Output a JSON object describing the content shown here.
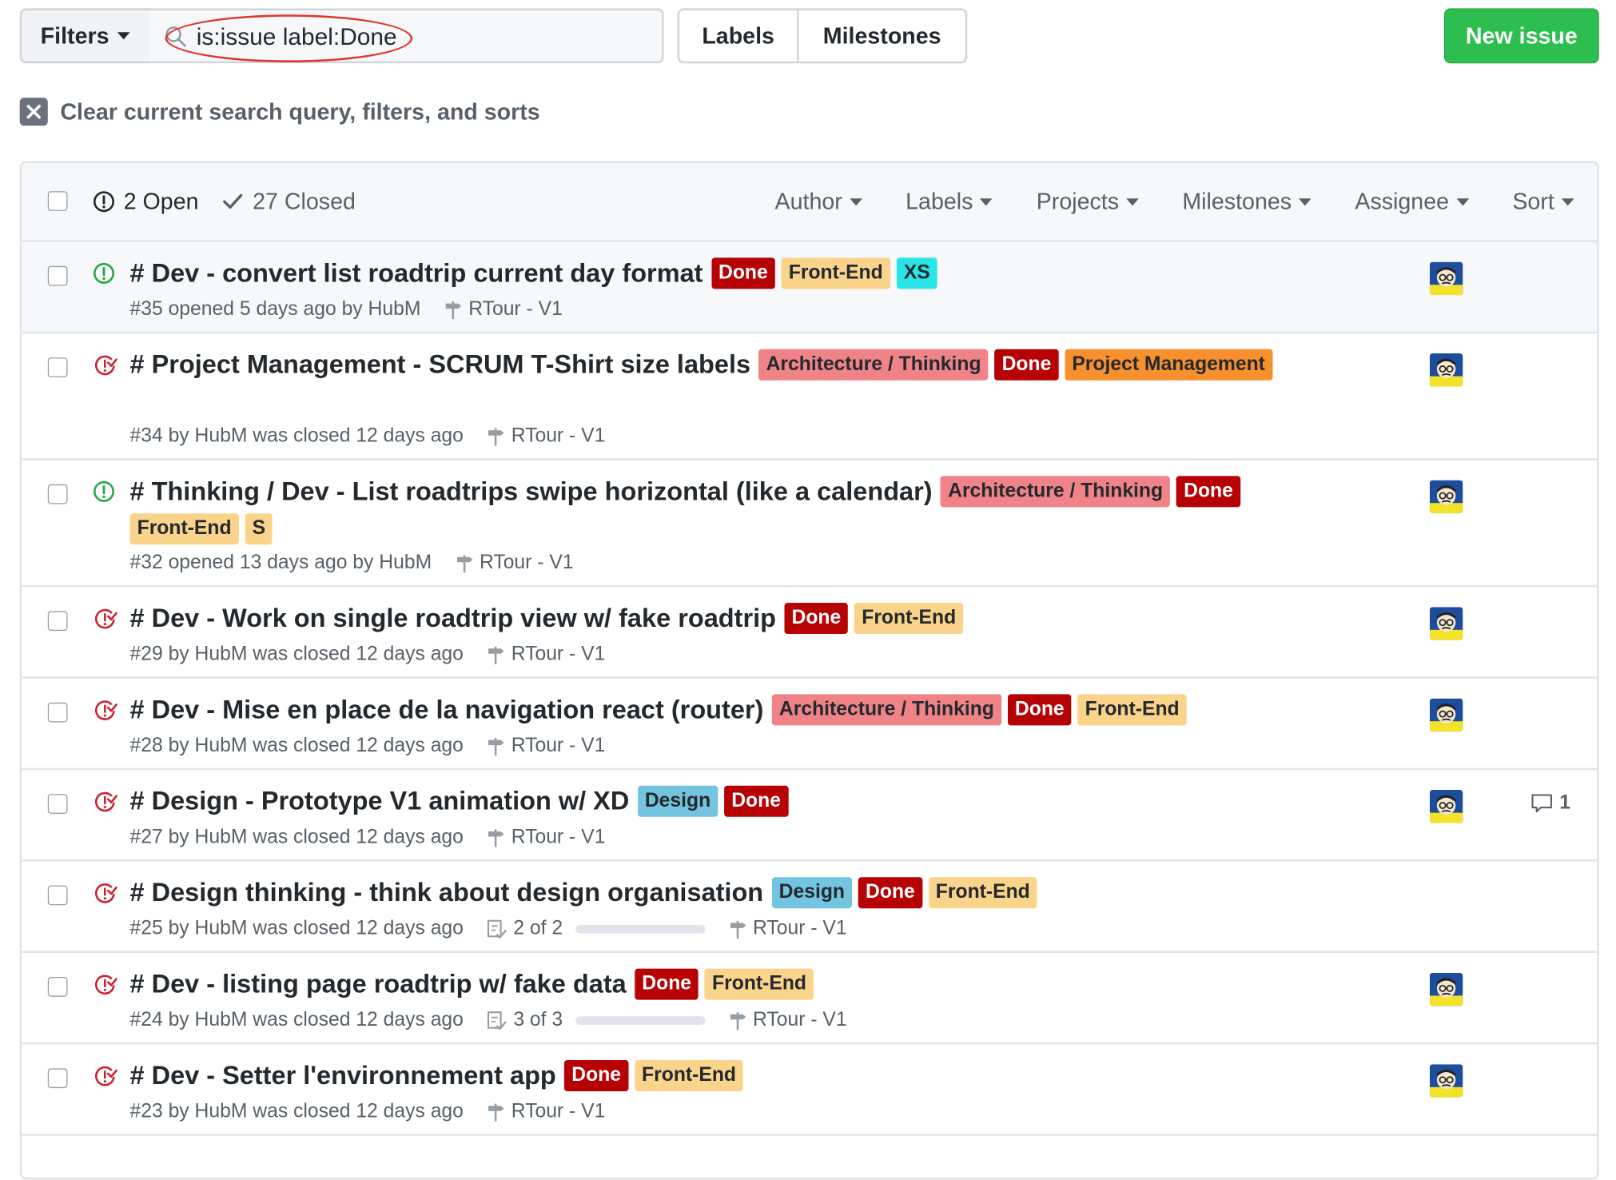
{
  "topbar": {
    "filters_label": "Filters",
    "search_value": "is:issue label:Done",
    "labels_btn": "Labels",
    "milestones_btn": "Milestones",
    "new_issue_btn": "New issue"
  },
  "clear_query": "Clear current search query, filters, and sorts",
  "header": {
    "open_count": "2 Open",
    "closed_count": "27 Closed",
    "filters": [
      "Author",
      "Labels",
      "Projects",
      "Milestones",
      "Assignee",
      "Sort"
    ]
  },
  "colors": {
    "Done": {
      "bg": "#b60205",
      "fg": "#ffffff"
    },
    "Front-End": {
      "bg": "#fbd48c",
      "fg": "#24292e"
    },
    "XS": {
      "bg": "#2ae5e8",
      "fg": "#24292e"
    },
    "Architecture / Thinking": {
      "bg": "#ef8387",
      "fg": "#24292e"
    },
    "Project Management": {
      "bg": "#f8902e",
      "fg": "#24292e"
    },
    "S": {
      "bg": "#fbd48c",
      "fg": "#24292e"
    },
    "Design": {
      "bg": "#73c4df",
      "fg": "#24292e"
    },
    "open_icon": "#28a745",
    "closed_icon": "#cb2431"
  },
  "issues": [
    {
      "state": "open",
      "title": "# Dev - convert list roadtrip current day format",
      "labels": [
        "Done",
        "Front-End",
        "XS"
      ],
      "meta": "#35 opened 5 days ago by HubM",
      "milestone": "RTour - V1",
      "avatar": true,
      "highlight": true
    },
    {
      "state": "closed",
      "title": "# Project Management - SCRUM T-Shirt size labels",
      "labels": [
        "Architecture / Thinking",
        "Done",
        "Project Management"
      ],
      "meta": "#34 by HubM was closed 12 days ago",
      "milestone": "RTour - V1",
      "avatar": true
    },
    {
      "state": "open",
      "title": "# Thinking / Dev - List roadtrips swipe horizontal (like a calendar)",
      "labels": [
        "Architecture / Thinking",
        "Done",
        "Front-End",
        "S"
      ],
      "meta": "#32 opened 13 days ago by HubM",
      "milestone": "RTour - V1",
      "avatar": true
    },
    {
      "state": "closed",
      "title": "# Dev - Work on single roadtrip view w/ fake roadtrip",
      "labels": [
        "Done",
        "Front-End"
      ],
      "meta": "#29 by HubM was closed 12 days ago",
      "milestone": "RTour - V1",
      "avatar": true
    },
    {
      "state": "closed",
      "title": "# Dev - Mise en place de la navigation react (router)",
      "labels": [
        "Architecture / Thinking",
        "Done",
        "Front-End"
      ],
      "meta": "#28 by HubM was closed 12 days ago",
      "milestone": "RTour - V1",
      "avatar": true
    },
    {
      "state": "closed",
      "title": "# Design - Prototype V1 animation w/ XD",
      "labels": [
        "Design",
        "Done"
      ],
      "meta": "#27 by HubM was closed 12 days ago",
      "milestone": "RTour - V1",
      "avatar": true,
      "comments": "1"
    },
    {
      "state": "closed",
      "title": "# Design thinking - think about design organisation",
      "labels": [
        "Design",
        "Done",
        "Front-End"
      ],
      "meta": "#25 by HubM was closed 12 days ago",
      "tasks": "2 of 2",
      "milestone": "RTour - V1",
      "avatar": false
    },
    {
      "state": "closed",
      "title": "# Dev - listing page roadtrip w/ fake data",
      "labels": [
        "Done",
        "Front-End"
      ],
      "meta": "#24 by HubM was closed 12 days ago",
      "tasks": "3 of 3",
      "milestone": "RTour - V1",
      "avatar": true
    },
    {
      "state": "closed",
      "title": "# Dev - Setter l'environnement app",
      "labels": [
        "Done",
        "Front-End"
      ],
      "meta": "#23 by HubM was closed 12 days ago",
      "milestone": "RTour - V1",
      "avatar": true
    }
  ]
}
